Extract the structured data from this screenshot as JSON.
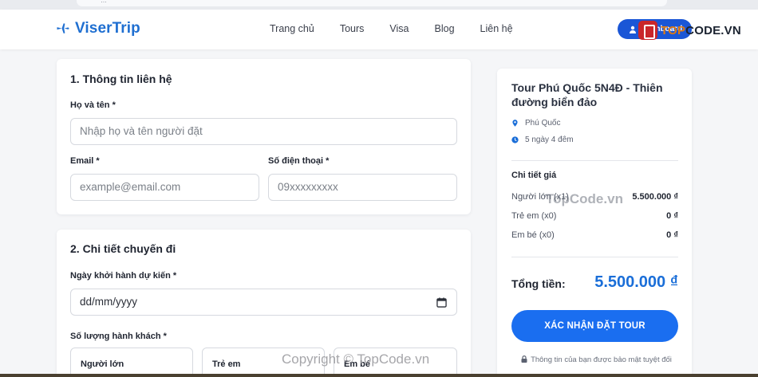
{
  "browser": {
    "url_text": "…"
  },
  "header": {
    "logo_text": "ViserTrip",
    "nav": [
      "Trang chủ",
      "Tours",
      "Visa",
      "Blog",
      "Liên hệ"
    ],
    "dashboard_label": "Dashboard"
  },
  "watermark": {
    "badge_prefix": "TOP",
    "badge_suffix": "CODE.VN",
    "center_text": "TopCode.vn",
    "bottom_text": "Copyright © TopCode.vn"
  },
  "contact": {
    "title": "1. Thông tin liên hệ",
    "name_label": "Họ và tên *",
    "name_placeholder": "Nhập họ và tên người đặt",
    "email_label": "Email *",
    "email_placeholder": "example@email.com",
    "phone_label": "Số điện thoại *",
    "phone_placeholder": "09xxxxxxxxx"
  },
  "trip": {
    "title": "2. Chi tiết chuyến đi",
    "date_label": "Ngày khởi hành dự kiến *",
    "date_placeholder": "dd/mm/yyyy",
    "pax_label": "Số lượng hành khách *",
    "pax_types": [
      "Người lớn",
      "Trẻ em",
      "Em bé"
    ]
  },
  "summary": {
    "title": "Tour Phú Quốc 5N4Đ - Thiên đường biển đảo",
    "location": "Phú Quốc",
    "duration": "5 ngày 4 đêm",
    "price_heading": "Chi tiết giá",
    "rows": [
      {
        "label": "Người lớn (x1)",
        "value": "5.500.000 ₫"
      },
      {
        "label": "Trẻ em (x0)",
        "value": "0 ₫"
      },
      {
        "label": "Em bé (x0)",
        "value": "0 ₫"
      }
    ],
    "total_label": "Tổng tiền:",
    "total_value": "5.500.000 ₫",
    "confirm_label": "XÁC NHẬN ĐẶT TOUR",
    "secure_note": "Thông tin của bạn được bảo mật tuyệt đối"
  },
  "colors": {
    "brand": "#1f6fd1",
    "button": "#1a6ef0",
    "total": "#1a6ed8"
  },
  "icons": [
    "plane-icon",
    "user-icon",
    "map-pin-icon",
    "clock-icon",
    "calendar-icon",
    "lock-icon"
  ]
}
